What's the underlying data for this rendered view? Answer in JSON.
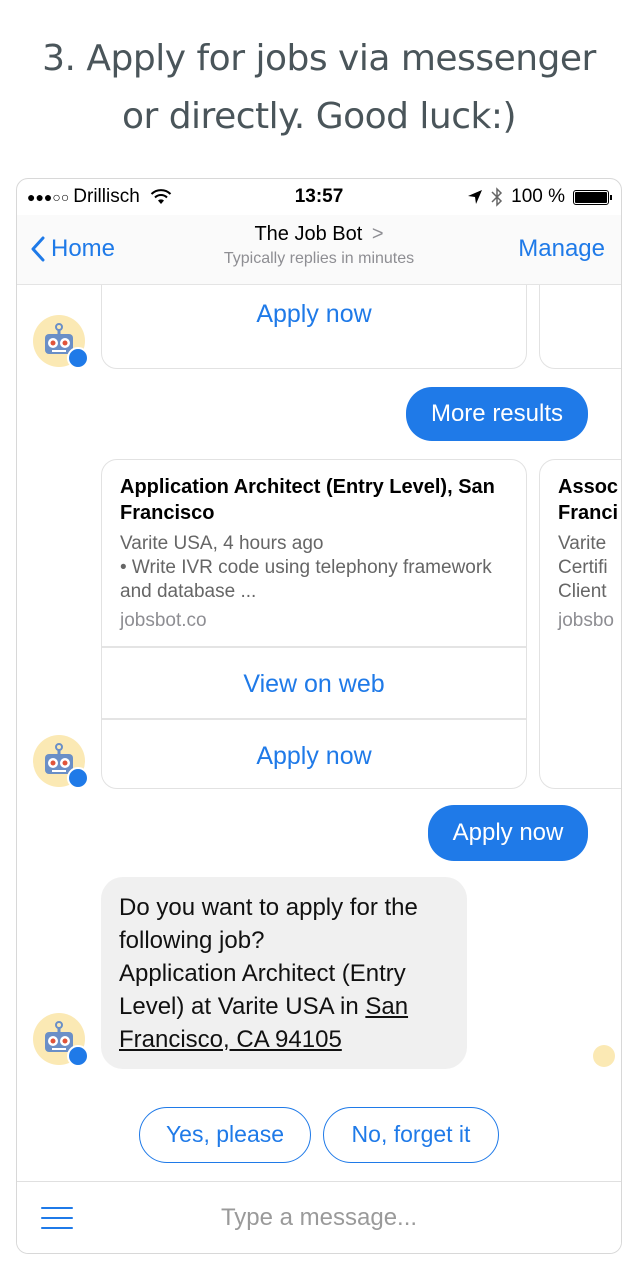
{
  "headline": {
    "line1": "3. Apply for jobs via messenger",
    "line2": "or directly. Good luck:)"
  },
  "statusbar": {
    "signal": "●●●○○",
    "carrier": "Drillisch",
    "time": "13:57",
    "battery": "100 %",
    "battery_level": 1.0
  },
  "navbar": {
    "back_label": "Home",
    "title": "The Job Bot",
    "title_arrow": ">",
    "subtitle": "Typically replies in minutes",
    "manage_label": "Manage"
  },
  "chat": {
    "top_card": {
      "apply_label": "Apply now"
    },
    "user_more_results": "More results",
    "job_card": {
      "title": "Application Architect (Entry Level), San Francisco",
      "meta_line1": "Varite USA, 4 hours ago",
      "meta_line2": "• Write IVR code using telephony framework and database ...",
      "link": "jobsbot.co",
      "view_label": "View on web",
      "apply_label": "Apply now"
    },
    "peek_card": {
      "title_line1": "Assoc",
      "title_line2": "Franci",
      "meta_line1": "Varite",
      "meta_line2": "Certifi",
      "meta_line3": "Client",
      "link": "jobsbo"
    },
    "user_apply_now": "Apply now",
    "bot_message": {
      "text_line1": "Do you want to apply for the",
      "text_line2": "following job?",
      "text_line3": "Application Architect (Entry",
      "text_line4_prefix": "Level) at Varite USA in ",
      "text_line4_link": "San",
      "text_line5_link": "Francisco, CA 94105"
    },
    "quick_replies": [
      "Yes, please",
      "No, forget it"
    ]
  },
  "composer": {
    "placeholder": "Type a message..."
  },
  "colors": {
    "accent": "#1f7ae8",
    "bot_bubble": "#f0f0f0",
    "avatar_bg": "#fbe9b4"
  }
}
